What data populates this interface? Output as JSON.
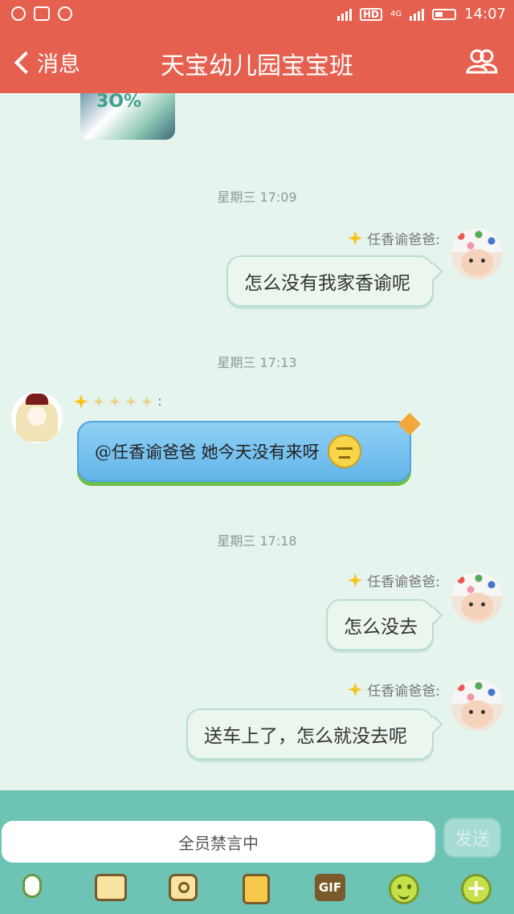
{
  "status_bar": {
    "time": "14:07",
    "network": "4G",
    "hd": "HD"
  },
  "header": {
    "back_label": "消息",
    "title": "天宝幼儿园宝宝班",
    "colors": {
      "background": "#e5604e",
      "text": "#ffffff"
    }
  },
  "chat": {
    "messages": [
      {
        "timestamp": "星期三 17:09",
        "sender": "任香谕爸爸:",
        "side": "right",
        "text": "怎么没有我家香谕呢"
      },
      {
        "timestamp": "星期三 17:13",
        "sender": ":",
        "side": "left",
        "text": "@任香谕爸爸 她今天没有来呀"
      },
      {
        "timestamp": "星期三 17:18",
        "sender": "任香谕爸爸:",
        "side": "right",
        "text": "怎么没去"
      },
      {
        "timestamp": "",
        "sender": "任香谕爸爸:",
        "side": "right",
        "text": "送车上了，怎么就没去呢"
      }
    ]
  },
  "composer": {
    "placeholder": "全员禁言中",
    "send_label": "发送",
    "gif_label": "GIF"
  },
  "icons": [
    "mic-icon",
    "image-icon",
    "camera-icon",
    "file-icon",
    "gif-icon",
    "emoji-icon",
    "plus-icon",
    "group-members-icon",
    "back-chevron-icon"
  ]
}
